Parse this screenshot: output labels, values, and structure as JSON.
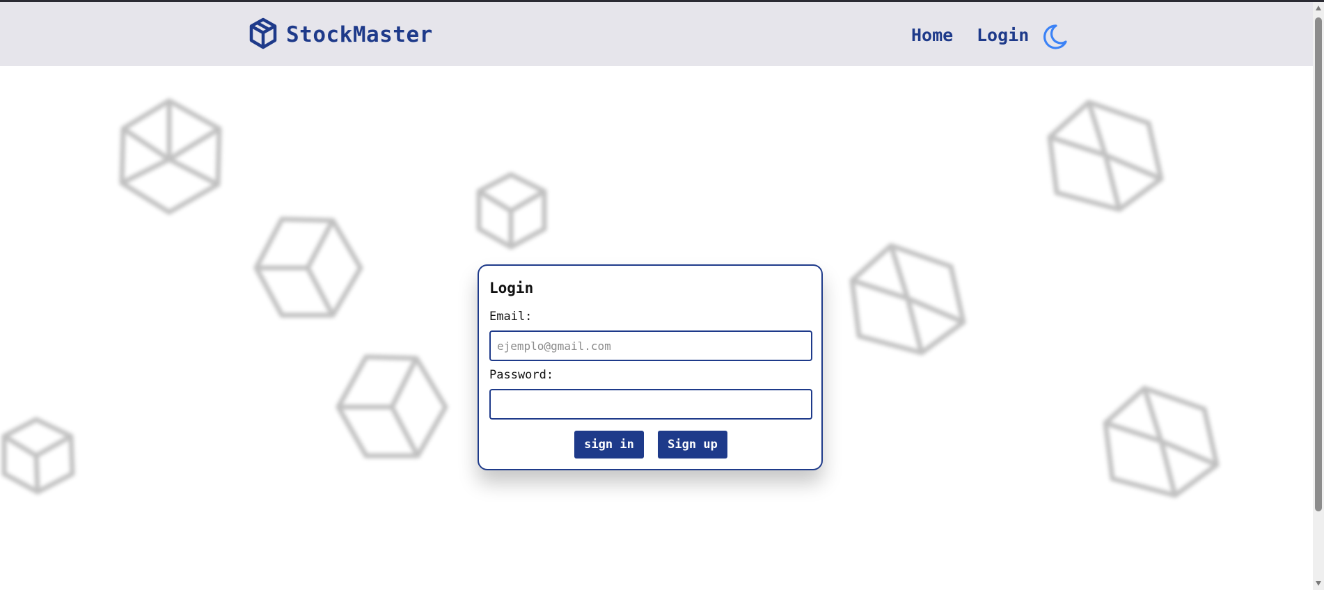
{
  "header": {
    "brand": "StockMaster",
    "nav": {
      "home": "Home",
      "login": "Login"
    },
    "icons": {
      "logo": "cube-icon",
      "theme_toggle": "moon-icon"
    }
  },
  "login_form": {
    "title": "Login",
    "email_label": "Email:",
    "email_placeholder": "ejemplo@gmail.com",
    "email_value": "",
    "password_label": "Password:",
    "password_value": "",
    "sign_in_label": "sign in",
    "sign_up_label": "Sign up"
  },
  "colors": {
    "brand": "#1e3a8a",
    "navbar_bg": "#e6e5eb",
    "moon": "#3b82f6",
    "background": "#ffffff"
  }
}
